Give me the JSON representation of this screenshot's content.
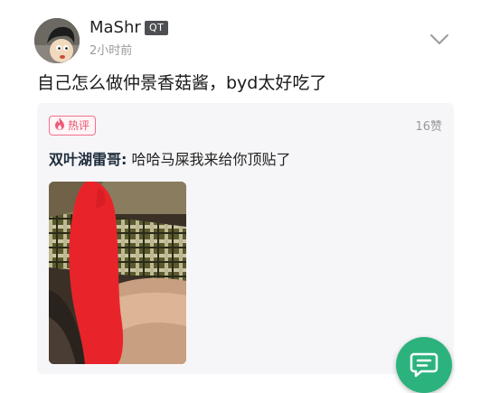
{
  "post": {
    "username": "MaShr",
    "badge": "QT",
    "time": "2小时前",
    "title": "自己怎么做仲景香菇酱，byd太好吃了"
  },
  "hot_comment": {
    "tag_label": "热评",
    "likes": "16赞",
    "author": "双叶湖雷哥:",
    "text": " 哈哈马屎我来给你顶贴了",
    "tag_color": "#e8536f"
  },
  "icons": {
    "more": "chevron-down-icon",
    "hot": "flame-icon",
    "comment": "chat-bubble-icon"
  },
  "colors": {
    "accent": "#2cb37d",
    "badge_bg": "#4d4f52",
    "redaction": "#e8242a"
  }
}
